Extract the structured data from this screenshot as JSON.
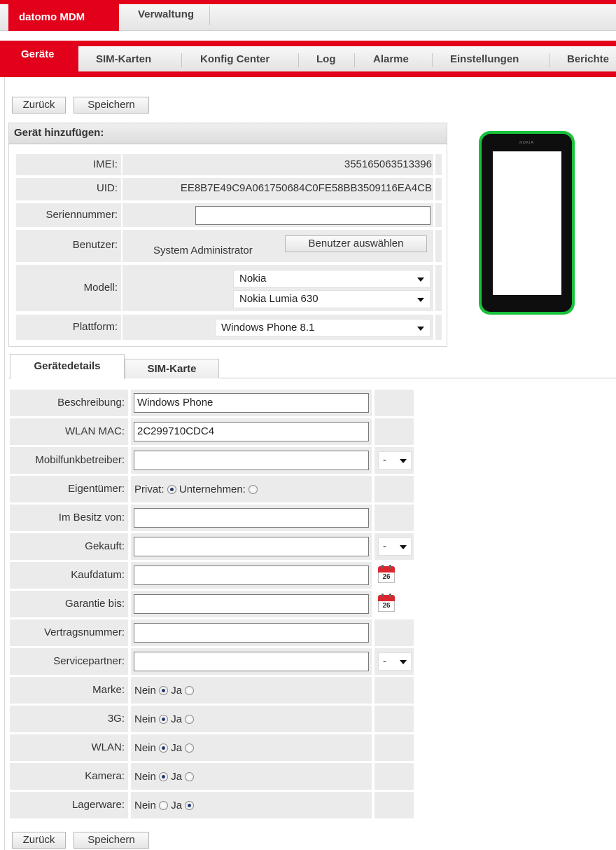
{
  "app": {
    "brand": "datomo MDM",
    "top_menu": "Verwaltung"
  },
  "nav": {
    "active": "Geräte",
    "items": [
      "SIM-Karten",
      "Konfig Center",
      "Log",
      "Alarme",
      "Einstellungen",
      "Berichte"
    ]
  },
  "buttons": {
    "back": "Zurück",
    "save": "Speichern",
    "select_user": "Benutzer auswählen"
  },
  "device": {
    "section_title": "Gerät hinzufügen:",
    "imei_label": "IMEI:",
    "imei": "355165063513396",
    "uid_label": "UID:",
    "uid": "EE8B7E49C9A061750684C0FE58BB3509116EA4CB",
    "serial_label": "Seriennummer:",
    "serial": "",
    "user_label": "Benutzer:",
    "user": "System Administrator",
    "model_label": "Modell:",
    "manufacturer": "Nokia",
    "model": "Nokia Lumia 630",
    "platform_label": "Plattform:",
    "platform": "Windows Phone 8.1",
    "phone_brand": "NOKIA"
  },
  "tabs": [
    "Gerätedetails",
    "SIM-Karte"
  ],
  "details": {
    "description_label": "Beschreibung:",
    "description": "Windows Phone",
    "wlan_mac_label": "WLAN MAC:",
    "wlan_mac": "2C299710CDC4",
    "carrier_label": "Mobilfunkbetreiber:",
    "carrier": "",
    "carrier_select": "-",
    "owner_label": "Eigentümer:",
    "owner_private": "Privat:",
    "owner_company": "Unternehmen:",
    "owner_value": "Privat",
    "holder_label": "Im Besitz von:",
    "holder": "",
    "bought_label": "Gekauft:",
    "bought": "",
    "bought_select": "-",
    "purchase_date_label": "Kaufdatum:",
    "purchase_date": "",
    "warranty_label": "Garantie bis:",
    "warranty": "",
    "contract_label": "Vertragsnummer:",
    "contract": "",
    "partner_label": "Servicepartner:",
    "partner": "",
    "partner_select": "-",
    "calendar_day": "26",
    "no": "Nein",
    "yes": "Ja",
    "toggles": [
      {
        "label": "Marke:",
        "value": "Nein"
      },
      {
        "label": "3G:",
        "value": "Nein"
      },
      {
        "label": "WLAN:",
        "value": "Nein"
      },
      {
        "label": "Kamera:",
        "value": "Nein"
      },
      {
        "label": "Lagerware:",
        "value": "Ja"
      }
    ]
  }
}
